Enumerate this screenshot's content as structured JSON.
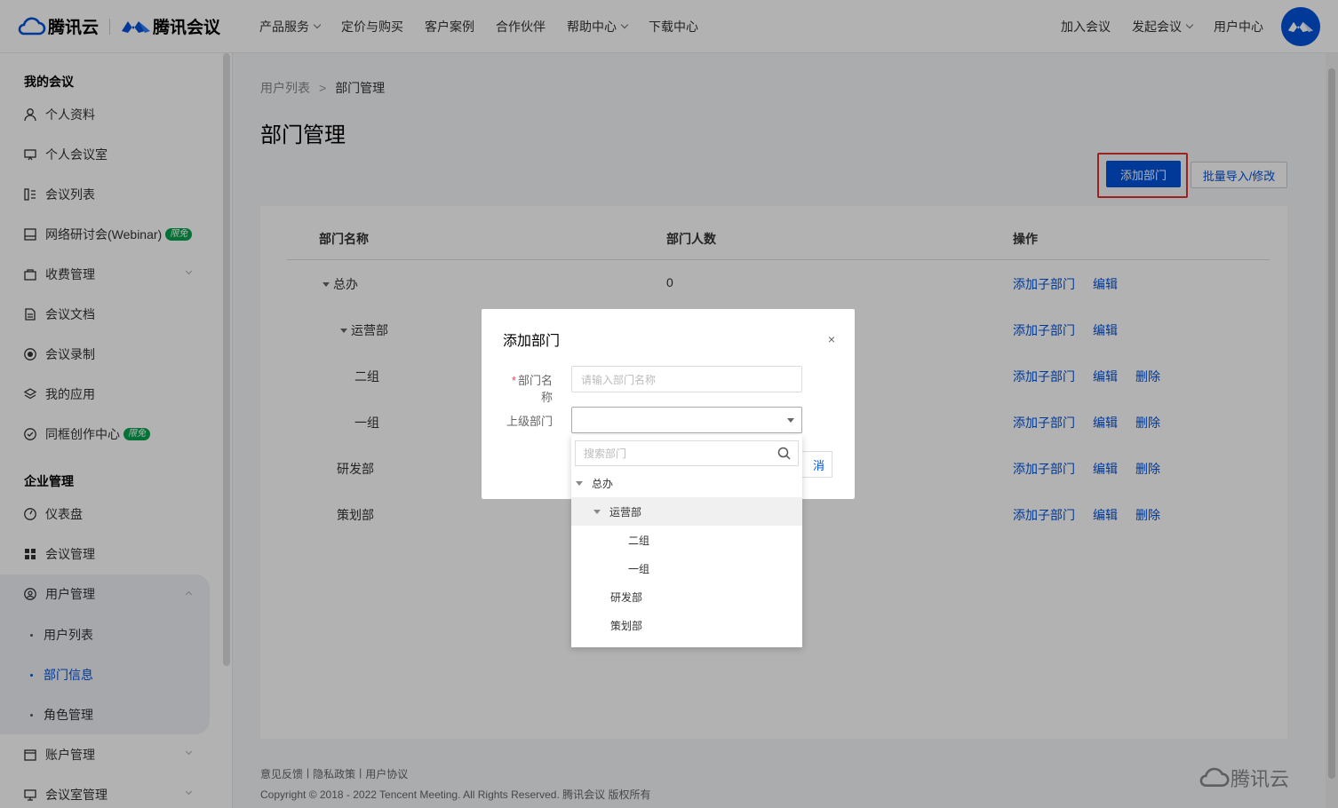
{
  "header": {
    "brand1": "腾讯云",
    "brand2": "腾讯会议",
    "nav": [
      {
        "label": "产品服务",
        "dropdown": true
      },
      {
        "label": "定价与购买",
        "dropdown": false
      },
      {
        "label": "客户案例",
        "dropdown": false
      },
      {
        "label": "合作伙伴",
        "dropdown": false
      },
      {
        "label": "帮助中心",
        "dropdown": true
      },
      {
        "label": "下载中心",
        "dropdown": false
      }
    ],
    "right": {
      "join": "加入会议",
      "start": "发起会议",
      "user_center": "用户中心"
    }
  },
  "sidebar": {
    "section1": "我的会议",
    "items1": [
      {
        "label": "个人资料",
        "icon": "user-icon"
      },
      {
        "label": "个人会议室",
        "icon": "room-icon"
      },
      {
        "label": "会议列表",
        "icon": "list-icon"
      },
      {
        "label": "网络研讨会(Webinar)",
        "icon": "webinar-icon",
        "tag": "限免"
      },
      {
        "label": "收费管理",
        "icon": "bag-icon"
      },
      {
        "label": "会议文档",
        "icon": "doc-icon"
      },
      {
        "label": "会议录制",
        "icon": "record-icon"
      },
      {
        "label": "我的应用",
        "icon": "layers-icon"
      },
      {
        "label": "同框创作中心",
        "icon": "create-icon",
        "tag": "限免"
      }
    ],
    "section2": "企业管理",
    "items2": [
      {
        "label": "仪表盘",
        "icon": "dashboard-icon"
      },
      {
        "label": "会议管理",
        "icon": "grid-icon"
      },
      {
        "label": "用户管理",
        "icon": "users-icon"
      }
    ],
    "sub_items": [
      {
        "label": "用户列表"
      },
      {
        "label": "部门信息"
      },
      {
        "label": "角色管理"
      }
    ],
    "items3": [
      {
        "label": "账户管理",
        "icon": "account-icon"
      },
      {
        "label": "会议室管理",
        "icon": "meetingroom-icon"
      }
    ]
  },
  "main": {
    "breadcrumb": {
      "parent": "用户列表",
      "sep": ">",
      "current": "部门管理"
    },
    "title": "部门管理",
    "add_button": "添加部门",
    "import_button": "批量导入/修改",
    "columns": [
      "部门名称",
      "部门人数",
      "操作"
    ],
    "rows": [
      {
        "name": "总办",
        "count": "0",
        "ops": [
          "添加子部门",
          "编辑"
        ]
      },
      {
        "name": "运营部",
        "count": "",
        "ops": [
          "添加子部门",
          "编辑"
        ]
      },
      {
        "name": "二组",
        "count": "",
        "ops": [
          "添加子部门",
          "编辑",
          "删除"
        ]
      },
      {
        "name": "一组",
        "count": "",
        "ops": [
          "添加子部门",
          "编辑",
          "删除"
        ]
      },
      {
        "name": "研发部",
        "count": "",
        "ops": [
          "添加子部门",
          "编辑",
          "删除"
        ]
      },
      {
        "name": "策划部",
        "count": "",
        "ops": [
          "添加子部门",
          "编辑",
          "删除"
        ]
      }
    ],
    "footer": {
      "links": [
        "意见反馈",
        "隐私政策",
        "用户协议"
      ],
      "copyright": "Copyright © 2018 - 2022 Tencent Meeting. All Rights Reserved. 腾讯会议 版权所有",
      "logo": "腾讯云"
    }
  },
  "modal": {
    "title": "添加部门",
    "close": "×",
    "name_label": "部门名称",
    "name_placeholder": "请输入部门名称",
    "parent_label": "上级部门",
    "cancel_label": "消"
  },
  "dropdown": {
    "search_placeholder": "搜索部门",
    "items": [
      {
        "label": "总办"
      },
      {
        "label": "运营部"
      },
      {
        "label": "二组"
      },
      {
        "label": "一组"
      },
      {
        "label": "研发部"
      },
      {
        "label": "策划部"
      }
    ]
  },
  "colors": {
    "primary": "#0052d9",
    "tag_green": "#07a34e",
    "highlight_red": "#e03030"
  }
}
